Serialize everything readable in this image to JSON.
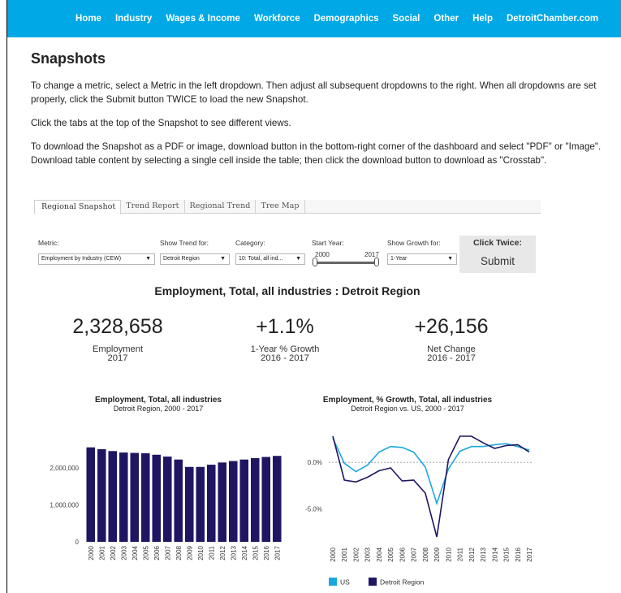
{
  "nav": {
    "items": [
      "Home",
      "Industry",
      "Wages & Income",
      "Workforce",
      "Demographics",
      "Social",
      "Other",
      "Help",
      "DetroitChamber.com"
    ]
  },
  "page": {
    "title": "Snapshots",
    "para1": "To change a metric, select a Metric in the left dropdown. Then adjust all subsequent dropdowns to the right. When all dropdowns are set properly, click the Submit button TWICE to load the new Snapshot.",
    "para2": "Click the tabs at the top of the Snapshot to see different views.",
    "para3": "To download the Snapshot as a PDF or image, download button in the bottom-right corner of the dashboard and select \"PDF\" or \"Image\". Download table content by selecting a single cell inside the table; then click the download button to download as \"Crosstab\"."
  },
  "tabs": [
    "Regional Snapshot",
    "Trend Report",
    "Regional Trend",
    "Tree Map"
  ],
  "controls": {
    "metric_label": "Metric:",
    "metric_value": "Employment by Industry (CEW)",
    "trend_label": "Show Trend for:",
    "trend_value": "Detroit Region",
    "category_label": "Category:",
    "category_value": "10: Total, all ind...",
    "start_label": "Start Year:",
    "start_min": "2000",
    "start_max": "2017",
    "growth_label": "Show Growth for:",
    "growth_value": "1-Year",
    "click_twice": "Click Twice:",
    "submit": "Submit"
  },
  "dashboard": {
    "title": "Employment, Total, all industries : Detroit Region",
    "kpis": [
      {
        "value": "2,328,658",
        "label": "Employment",
        "sub": "2017"
      },
      {
        "value": "+1.1%",
        "label": "1-Year % Growth",
        "sub": "2016 - 2017"
      },
      {
        "value": "+26,156",
        "label": "Net Change",
        "sub": "2016 - 2017"
      }
    ]
  },
  "colors": {
    "nav": "#00a8e6",
    "bar": "#1f1663",
    "us_line": "#1aa8dc",
    "detroit_line": "#1f1663"
  },
  "chart_data": [
    {
      "type": "bar",
      "title": "Employment, Total, all industries",
      "subtitle": "Detroit Region, 2000 - 2017",
      "categories": [
        "2000",
        "2001",
        "2002",
        "2003",
        "2004",
        "2005",
        "2006",
        "2007",
        "2008",
        "2009",
        "2010",
        "2011",
        "2012",
        "2013",
        "2014",
        "2015",
        "2016",
        "2017"
      ],
      "values": [
        2560000,
        2510000,
        2460000,
        2420000,
        2410000,
        2400000,
        2360000,
        2310000,
        2230000,
        2030000,
        2030000,
        2090000,
        2150000,
        2190000,
        2230000,
        2270000,
        2300000,
        2328658
      ],
      "yticks": [
        "2,000,000",
        "1,000,000",
        "0"
      ],
      "ytick_values": [
        2000000,
        1000000,
        0
      ],
      "ylim": [
        0,
        2950000
      ]
    },
    {
      "type": "line",
      "title": "Employment, % Growth, Total, all industries",
      "subtitle": "Detroit Region vs. US, 2000 - 2017",
      "categories": [
        "2000",
        "2001",
        "2002",
        "2003",
        "2004",
        "2005",
        "2006",
        "2007",
        "2008",
        "2009",
        "2010",
        "2011",
        "2012",
        "2013",
        "2014",
        "2015",
        "2016",
        "2017"
      ],
      "series": [
        {
          "name": "US",
          "values": [
            2.6,
            -0.1,
            -1.0,
            -0.3,
            1.1,
            1.7,
            1.6,
            1.1,
            -0.5,
            -4.4,
            -0.7,
            1.2,
            1.7,
            1.7,
            1.9,
            2.0,
            1.7,
            1.3
          ]
        },
        {
          "name": "Detroit Region",
          "values": [
            2.8,
            -1.9,
            -2.1,
            -1.6,
            -0.9,
            -0.6,
            -2.0,
            -1.9,
            -3.3,
            -8.0,
            0.3,
            2.8,
            2.8,
            2.1,
            1.5,
            1.8,
            1.9,
            1.1
          ]
        }
      ],
      "yticks": [
        "0.0%",
        "-5.0%"
      ],
      "ytick_values": [
        0,
        -5
      ],
      "ylim": [
        -8.7,
        3.5
      ],
      "legend": "bottom-left"
    }
  ]
}
